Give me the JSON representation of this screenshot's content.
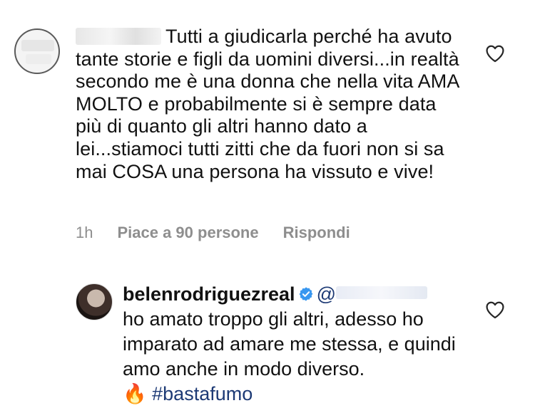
{
  "comment": {
    "text": "Tutti a giudicarla perché ha avuto tante storie e figli da uomini diversi...in realtà secondo me è una donna che nella vita AMA MOLTO e probabilmente si è sempre data più di quanto gli altri hanno dato a lei...stiamoci tutti zitti che da fuori non si sa mai COSA una persona ha vissuto e vive!",
    "time": "1h",
    "likes": "Piace a 90 persone",
    "reply_label": "Rispondi"
  },
  "reply": {
    "username": "belenrodriguezreal",
    "mention_prefix": "@",
    "text": "ho amato troppo gli altri, adesso ho imparato ad amare me stessa, e quindi amo anche in modo diverso.",
    "emoji": "🔥",
    "hashtag": "#bastafumo"
  },
  "icons": {
    "like": "heart-icon",
    "verified": "verified-badge-icon"
  },
  "colors": {
    "meta": "#8e8e8e",
    "link": "#1d3a75",
    "verified": "#3897f0"
  }
}
